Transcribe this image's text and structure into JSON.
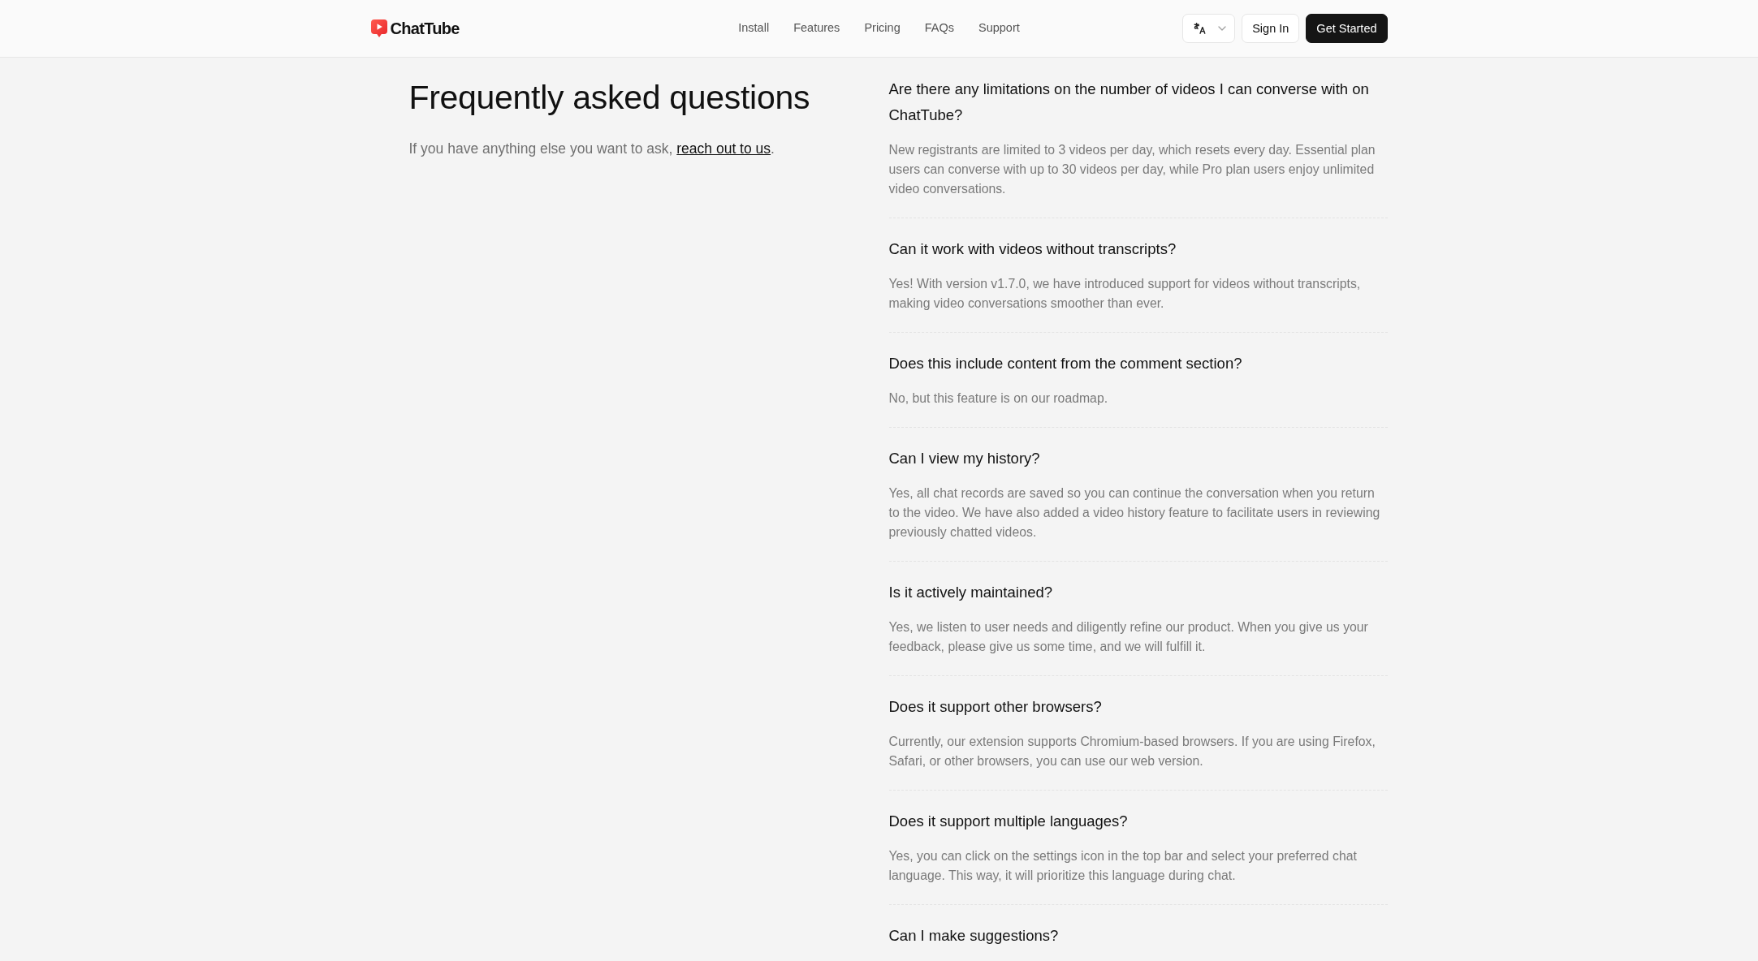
{
  "brand": {
    "name": "ChatTube"
  },
  "nav": {
    "links": [
      {
        "label": "Install"
      },
      {
        "label": "Features"
      },
      {
        "label": "Pricing"
      },
      {
        "label": "FAQs"
      },
      {
        "label": "Support"
      }
    ]
  },
  "actions": [
    {
      "label": "Sign In",
      "kind": "outline"
    },
    {
      "label": "Get Started",
      "kind": "primary"
    }
  ],
  "intro": {
    "title": "Frequently asked questions",
    "text": "If you have anything else you want to ask, ",
    "link": "reach out to us",
    "after": "."
  },
  "faqs": [
    {
      "question": "Are there any limitations on the number of videos I can converse with on ChatTube?",
      "answer": "New registrants are limited to 3 videos per day, which resets every day. Essential plan users can converse with up to 30 videos per day, while Pro plan users enjoy unlimited video conversations."
    },
    {
      "question": "Can it work with videos without transcripts?",
      "answer": "Yes! With version v1.7.0, we have introduced support for videos without transcripts, making video conversations smoother than ever."
    },
    {
      "question": "Does this include content from the comment section?",
      "answer": "No, but this feature is on our roadmap."
    },
    {
      "question": "Can I view my history?",
      "answer": "Yes, all chat records are saved so you can continue the conversation when you return to the video. We have also added a video history feature to facilitate users in reviewing previously chatted videos."
    },
    {
      "question": "Is it actively maintained?",
      "answer": "Yes, we listen to user needs and diligently refine our product. When you give us your feedback, please give us some time, and we will fulfill it."
    },
    {
      "question": "Does it support other browsers?",
      "answer": "Currently, our extension supports Chromium-based browsers. If you are using Firefox, Safari, or other browsers, you can use our web version."
    },
    {
      "question": "Does it support multiple languages?",
      "answer": "Yes, you can click on the settings icon in the top bar and select your preferred chat language. This way, it will prioritize this language during chat."
    },
    {
      "question": "Can I make suggestions?"
    }
  ]
}
